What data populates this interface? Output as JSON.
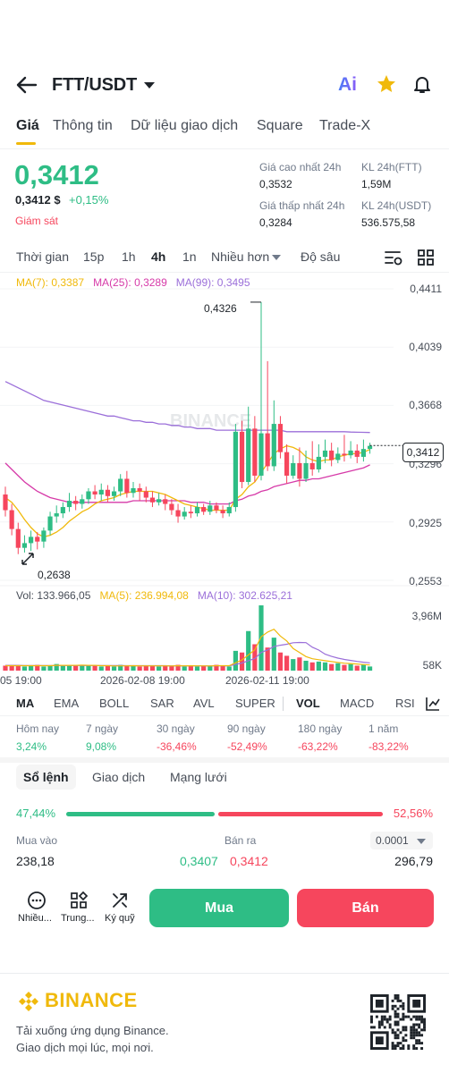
{
  "header": {
    "pair": "FTT/USDT",
    "ai_label": "Ai"
  },
  "tabs": [
    "Giá",
    "Thông tin",
    "Dữ liệu giao dịch",
    "Square",
    "Trade-X"
  ],
  "ticker": {
    "price": "0,3412",
    "price_usd": "0,3412 $",
    "change": "+0,15%",
    "monitor": "Giám sát",
    "high_label": "Giá cao nhất 24h",
    "high": "0,3532",
    "low_label": "Giá thấp nhất 24h",
    "low": "0,3284",
    "vol_ftt_label": "KL 24h(FTT)",
    "vol_ftt": "1,59M",
    "vol_usdt_label": "KL 24h(USDT)",
    "vol_usdt": "536.575,58"
  },
  "timebar": [
    "Thời gian",
    "15p",
    "1h",
    "4h",
    "1n",
    "Nhiều hơn",
    "Độ sâu"
  ],
  "chart_ma": {
    "ma7": "MA(7): 0,3387",
    "ma25": "MA(25): 0,3289",
    "ma99": "MA(99): 0,3495"
  },
  "chart_data": {
    "type": "candlestick",
    "ylim": [
      0.2553,
      0.4411
    ],
    "y_ticks": [
      "0,4411",
      "0,4039",
      "0,3668",
      "0,3296",
      "0,2925",
      "0,2553"
    ],
    "high_label": "0,4326",
    "low_label": "0,2638",
    "current_label": "0,3412",
    "x_ticks": [
      "05 19:00",
      "2026-02-08 19:00",
      "2026-02-11 19:00"
    ],
    "watermark": "BINANCE",
    "candles": [
      [
        0.31,
        0.3,
        0.315,
        0.296
      ],
      [
        0.3,
        0.288,
        0.304,
        0.284
      ],
      [
        0.288,
        0.276,
        0.292,
        0.272
      ],
      [
        0.276,
        0.279,
        0.284,
        0.273
      ],
      [
        0.279,
        0.283,
        0.287,
        0.274
      ],
      [
        0.283,
        0.28,
        0.286,
        0.275
      ],
      [
        0.28,
        0.287,
        0.289,
        0.276
      ],
      [
        0.287,
        0.296,
        0.299,
        0.284
      ],
      [
        0.296,
        0.298,
        0.303,
        0.292
      ],
      [
        0.298,
        0.302,
        0.305,
        0.295
      ],
      [
        0.302,
        0.306,
        0.311,
        0.299
      ],
      [
        0.306,
        0.304,
        0.309,
        0.3
      ],
      [
        0.304,
        0.307,
        0.31,
        0.301
      ],
      [
        0.307,
        0.312,
        0.314,
        0.304
      ],
      [
        0.312,
        0.31,
        0.316,
        0.307
      ],
      [
        0.31,
        0.313,
        0.317,
        0.306
      ],
      [
        0.313,
        0.309,
        0.316,
        0.305
      ],
      [
        0.309,
        0.312,
        0.315,
        0.306
      ],
      [
        0.312,
        0.32,
        0.323,
        0.309
      ],
      [
        0.32,
        0.311,
        0.325,
        0.308
      ],
      [
        0.311,
        0.314,
        0.318,
        0.308
      ],
      [
        0.314,
        0.312,
        0.317,
        0.306
      ],
      [
        0.312,
        0.308,
        0.315,
        0.305
      ],
      [
        0.308,
        0.305,
        0.312,
        0.302
      ],
      [
        0.305,
        0.307,
        0.311,
        0.303
      ],
      [
        0.307,
        0.304,
        0.31,
        0.3
      ],
      [
        0.304,
        0.3,
        0.307,
        0.297
      ],
      [
        0.3,
        0.296,
        0.304,
        0.292
      ],
      [
        0.296,
        0.299,
        0.302,
        0.294
      ],
      [
        0.299,
        0.298,
        0.303,
        0.295
      ],
      [
        0.298,
        0.302,
        0.305,
        0.296
      ],
      [
        0.302,
        0.299,
        0.304,
        0.297
      ],
      [
        0.299,
        0.303,
        0.306,
        0.297
      ],
      [
        0.303,
        0.3,
        0.305,
        0.298
      ],
      [
        0.3,
        0.298,
        0.303,
        0.295
      ],
      [
        0.298,
        0.302,
        0.305,
        0.296
      ],
      [
        0.302,
        0.35,
        0.355,
        0.299
      ],
      [
        0.35,
        0.318,
        0.357,
        0.314
      ],
      [
        0.318,
        0.352,
        0.366,
        0.316
      ],
      [
        0.352,
        0.322,
        0.36,
        0.318
      ],
      [
        0.322,
        0.349,
        0.4326,
        0.319
      ],
      [
        0.349,
        0.328,
        0.395,
        0.325
      ],
      [
        0.328,
        0.355,
        0.37,
        0.325
      ],
      [
        0.355,
        0.337,
        0.36,
        0.333
      ],
      [
        0.337,
        0.322,
        0.342,
        0.317
      ],
      [
        0.322,
        0.33,
        0.335,
        0.32
      ],
      [
        0.33,
        0.32,
        0.34,
        0.315
      ],
      [
        0.32,
        0.33,
        0.338,
        0.318
      ],
      [
        0.33,
        0.326,
        0.344,
        0.322
      ],
      [
        0.326,
        0.334,
        0.342,
        0.324
      ],
      [
        0.334,
        0.338,
        0.345,
        0.33
      ],
      [
        0.338,
        0.332,
        0.343,
        0.328
      ],
      [
        0.332,
        0.336,
        0.34,
        0.33
      ],
      [
        0.336,
        0.335,
        0.348,
        0.331
      ],
      [
        0.335,
        0.338,
        0.344,
        0.333
      ],
      [
        0.338,
        0.334,
        0.342,
        0.33
      ],
      [
        0.334,
        0.339,
        0.345,
        0.331
      ],
      [
        0.339,
        0.341,
        0.343,
        0.336
      ]
    ],
    "ma7": [
      0.308,
      0.305,
      0.3,
      0.294,
      0.289,
      0.285,
      0.283,
      0.284,
      0.286,
      0.289,
      0.293,
      0.296,
      0.299,
      0.301,
      0.304,
      0.306,
      0.307,
      0.308,
      0.31,
      0.311,
      0.312,
      0.312,
      0.312,
      0.312,
      0.311,
      0.31,
      0.308,
      0.306,
      0.304,
      0.303,
      0.302,
      0.301,
      0.3,
      0.3,
      0.3,
      0.3,
      0.307,
      0.31,
      0.315,
      0.318,
      0.324,
      0.33,
      0.336,
      0.339,
      0.341,
      0.34,
      0.338,
      0.334,
      0.332,
      0.331,
      0.332,
      0.332,
      0.334,
      0.335,
      0.336,
      0.336,
      0.337,
      0.3387
    ],
    "ma25": [
      0.33,
      0.326,
      0.322,
      0.318,
      0.315,
      0.312,
      0.31,
      0.308,
      0.307,
      0.306,
      0.305,
      0.305,
      0.305,
      0.305,
      0.305,
      0.305,
      0.305,
      0.305,
      0.305,
      0.305,
      0.306,
      0.306,
      0.306,
      0.306,
      0.306,
      0.306,
      0.306,
      0.306,
      0.306,
      0.305,
      0.305,
      0.305,
      0.304,
      0.304,
      0.304,
      0.304,
      0.306,
      0.307,
      0.309,
      0.31,
      0.312,
      0.313,
      0.315,
      0.316,
      0.317,
      0.318,
      0.319,
      0.319,
      0.32,
      0.32,
      0.321,
      0.322,
      0.323,
      0.324,
      0.325,
      0.326,
      0.327,
      0.3289
    ],
    "ma99": [
      0.382,
      0.38,
      0.378,
      0.376,
      0.374,
      0.372,
      0.37,
      0.369,
      0.368,
      0.367,
      0.366,
      0.365,
      0.364,
      0.363,
      0.362,
      0.361,
      0.36,
      0.36,
      0.359,
      0.358,
      0.357,
      0.357,
      0.356,
      0.356,
      0.355,
      0.355,
      0.354,
      0.354,
      0.353,
      0.353,
      0.352,
      0.352,
      0.352,
      0.351,
      0.351,
      0.351,
      0.351,
      0.351,
      0.351,
      0.351,
      0.351,
      0.351,
      0.351,
      0.351,
      0.35,
      0.35,
      0.35,
      0.35,
      0.35,
      0.35,
      0.35,
      0.35,
      0.35,
      0.35,
      0.3498,
      0.3497,
      0.3496,
      0.3495
    ],
    "volume": {
      "ylim": [
        0,
        3.96
      ],
      "y_ticks": [
        "3,96M",
        "58K"
      ],
      "bars": [
        0.3,
        0.35,
        0.3,
        0.25,
        0.3,
        0.35,
        0.25,
        0.3,
        0.4,
        0.3,
        0.35,
        0.3,
        0.35,
        0.3,
        0.3,
        0.25,
        0.3,
        0.25,
        0.35,
        0.3,
        0.3,
        0.25,
        0.3,
        0.3,
        0.25,
        0.3,
        0.3,
        0.35,
        0.25,
        0.3,
        0.25,
        0.3,
        0.3,
        0.35,
        0.3,
        0.25,
        1.2,
        1.1,
        2.4,
        1.6,
        3.96,
        1.4,
        2.0,
        1.1,
        0.9,
        0.7,
        0.8,
        0.6,
        0.5,
        0.55,
        0.5,
        0.4,
        0.45,
        0.35,
        0.4,
        0.3,
        0.35,
        0.25
      ],
      "ma5": [
        0.3,
        0.3,
        0.3,
        0.3,
        0.3,
        0.3,
        0.3,
        0.3,
        0.32,
        0.32,
        0.32,
        0.32,
        0.33,
        0.32,
        0.32,
        0.3,
        0.3,
        0.28,
        0.29,
        0.29,
        0.3,
        0.29,
        0.29,
        0.29,
        0.29,
        0.29,
        0.28,
        0.3,
        0.29,
        0.3,
        0.29,
        0.29,
        0.28,
        0.3,
        0.3,
        0.3,
        0.48,
        0.65,
        0.95,
        1.27,
        2.05,
        2.34,
        2.51,
        2.1,
        1.8,
        1.34,
        1.1,
        0.85,
        0.72,
        0.66,
        0.6,
        0.55,
        0.5,
        0.45,
        0.43,
        0.4,
        0.37,
        0.34
      ],
      "ma10": [
        0.32,
        0.32,
        0.32,
        0.31,
        0.31,
        0.31,
        0.31,
        0.31,
        0.31,
        0.31,
        0.31,
        0.31,
        0.31,
        0.31,
        0.31,
        0.31,
        0.31,
        0.31,
        0.31,
        0.3,
        0.3,
        0.3,
        0.3,
        0.3,
        0.3,
        0.3,
        0.29,
        0.29,
        0.29,
        0.29,
        0.29,
        0.29,
        0.29,
        0.29,
        0.29,
        0.29,
        0.38,
        0.46,
        0.6,
        0.73,
        1.1,
        1.26,
        1.46,
        1.54,
        1.6,
        1.69,
        1.71,
        1.7,
        1.42,
        1.25,
        1.0,
        0.86,
        0.76,
        0.68,
        0.62,
        0.56,
        0.51,
        0.47
      ]
    }
  },
  "volume_info": {
    "vol": "Vol: 133.966,05",
    "ma5": "MA(5): 236.994,08",
    "ma10": "MA(10): 302.625,21"
  },
  "indicators": [
    "MA",
    "EMA",
    "BOLL",
    "SAR",
    "AVL",
    "SUPER",
    "VOL",
    "MACD",
    "RSI"
  ],
  "performance": [
    {
      "label": "Hôm nay",
      "value": "3,24%"
    },
    {
      "label": "7 ngày",
      "value": "9,08%"
    },
    {
      "label": "30 ngày",
      "value": "-36,46%"
    },
    {
      "label": "90 ngày",
      "value": "-52,49%"
    },
    {
      "label": "180 ngày",
      "value": "-63,22%"
    },
    {
      "label": "1 năm",
      "value": "-83,22%"
    }
  ],
  "orderbook": {
    "tabs": [
      "Sổ lệnh",
      "Giao dịch",
      "Mạng lưới"
    ],
    "buy_ratio": "47,44%",
    "sell_ratio": "52,56%",
    "buy_fraction": 0.4744,
    "buy_label": "Mua vào",
    "sell_label": "Bán ra",
    "step": "0.0001",
    "row": {
      "bid_qty": "238,18",
      "bid_price": "0,3407",
      "ask_price": "0,3412",
      "ask_qty": "296,79"
    }
  },
  "bottom_bar": {
    "more": "Nhiều...",
    "trading": "Trung...",
    "margin": "Ký quỹ",
    "buy": "Mua",
    "sell": "Bán"
  },
  "footer": {
    "brand": "BINANCE",
    "line1": "Tải xuống ứng dụng Binance.",
    "line2": "Giao dịch mọi lúc, mọi nơi."
  },
  "colors": {
    "up": "#2ebd85",
    "down": "#f6465d",
    "brand": "#f0b90b",
    "ma7": "#f0b90b",
    "ma25": "#d63aa8",
    "ma99": "#9b6fd9"
  }
}
